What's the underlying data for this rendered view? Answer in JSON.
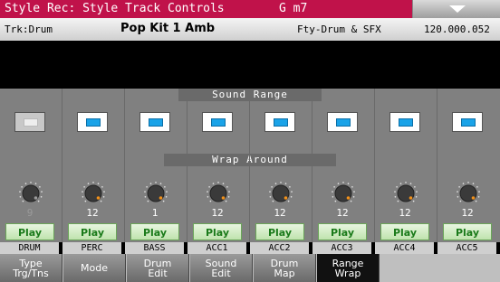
{
  "title_bar": {
    "title": "Style Rec: Style Track Controls",
    "chord": "G m7",
    "menu_icon": "chevron-down-icon"
  },
  "info_bar": {
    "track": "Trk:Drum",
    "kit": "Pop Kit 1 Amb",
    "bank": "Fty-Drum & SFX",
    "number": "120.000.052"
  },
  "sections": {
    "sound_range": "Sound Range",
    "wrap_around": "Wrap Around"
  },
  "colors": {
    "title": "#c0124a",
    "range_on": "#1aa3e8",
    "knob_indicator": "#f0901a",
    "play_text": "#1a7a1a"
  },
  "tracks": [
    {
      "name": "DRUM",
      "range_on": false,
      "wrap": "9",
      "wrap_active": false,
      "mode": "Play"
    },
    {
      "name": "PERC",
      "range_on": true,
      "wrap": "12",
      "wrap_active": true,
      "mode": "Play"
    },
    {
      "name": "BASS",
      "range_on": true,
      "wrap": "1",
      "wrap_active": true,
      "mode": "Play"
    },
    {
      "name": "ACC1",
      "range_on": true,
      "wrap": "12",
      "wrap_active": true,
      "mode": "Play"
    },
    {
      "name": "ACC2",
      "range_on": true,
      "wrap": "12",
      "wrap_active": true,
      "mode": "Play"
    },
    {
      "name": "ACC3",
      "range_on": true,
      "wrap": "12",
      "wrap_active": true,
      "mode": "Play"
    },
    {
      "name": "ACC4",
      "range_on": true,
      "wrap": "12",
      "wrap_active": true,
      "mode": "Play"
    },
    {
      "name": "ACC5",
      "range_on": true,
      "wrap": "12",
      "wrap_active": true,
      "mode": "Play"
    }
  ],
  "tabs": [
    {
      "label": "Type Trg/Tns",
      "active": false
    },
    {
      "label": "Mode",
      "active": false
    },
    {
      "label": "Drum Edit",
      "active": false
    },
    {
      "label": "Sound Edit",
      "active": false
    },
    {
      "label": "Drum Map",
      "active": false
    },
    {
      "label": "Range Wrap",
      "active": true
    }
  ]
}
